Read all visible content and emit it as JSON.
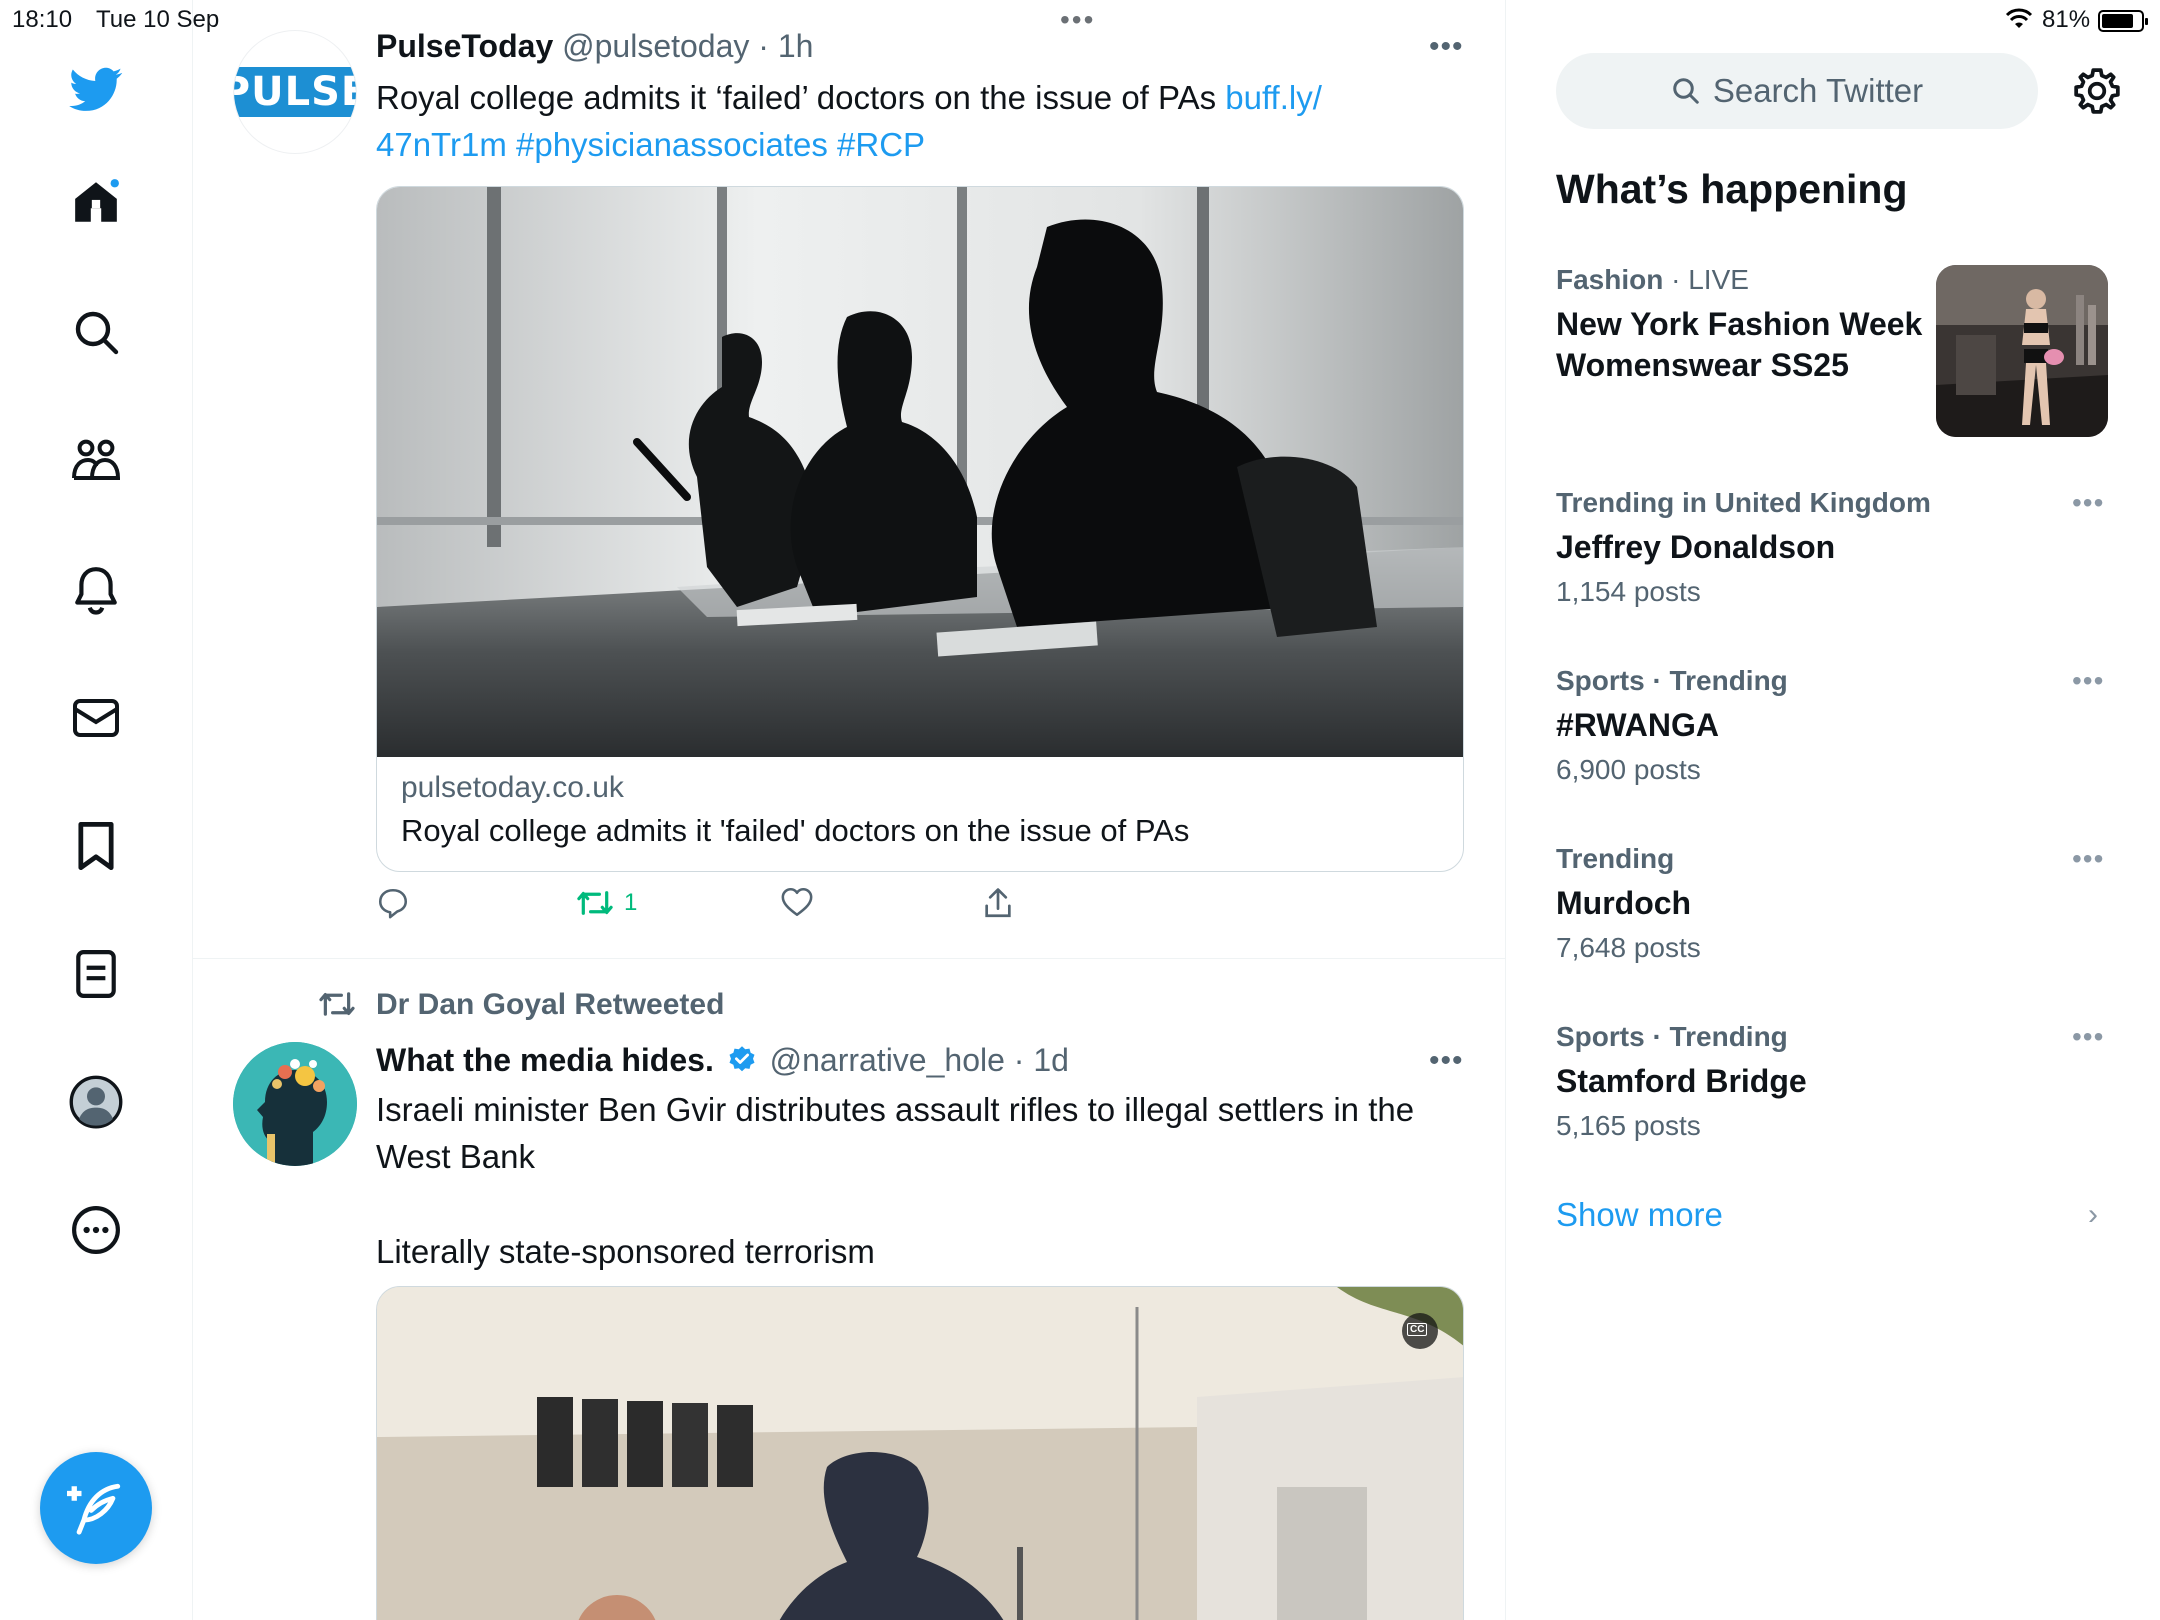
{
  "status_bar": {
    "time": "18:10",
    "date": "Tue 10 Sep",
    "battery_pct": "81%",
    "battery_level": 0.81
  },
  "nav": {
    "items": [
      {
        "name": "home",
        "icon": "home-icon"
      },
      {
        "name": "search",
        "icon": "search-icon"
      },
      {
        "name": "communities",
        "icon": "people-icon"
      },
      {
        "name": "notifications",
        "icon": "bell-icon"
      },
      {
        "name": "messages",
        "icon": "mail-icon"
      },
      {
        "name": "bookmarks",
        "icon": "bookmark-icon"
      },
      {
        "name": "lists",
        "icon": "list-icon"
      },
      {
        "name": "profile",
        "icon": "avatar-icon"
      },
      {
        "name": "more",
        "icon": "more-circle-icon"
      }
    ],
    "compose_icon": "compose-feather-icon",
    "brand_color": "#1d9bf0"
  },
  "tweets": [
    {
      "name": "PulseToday",
      "handle": "@pulsetoday",
      "sep": " · ",
      "time": "1h",
      "avatar_logo": "PULSE",
      "text_main": "Royal college admits it ‘failed’ doctors on the issue of PAs ",
      "text_link": "buff.ly/\n47nTr1m",
      "text_tags": " #physicianassociates #RCP",
      "card_domain": "pulsetoday.co.uk",
      "card_title": "Royal college admits it 'failed' doctors on the issue of PAs",
      "retweets": "1",
      "retweet_color": "#00ba7c"
    },
    {
      "retweeted_by": "Dr Dan Goyal Retweeted",
      "name": "What the media hides.",
      "verified": true,
      "handle": "@narrative_hole",
      "sep": " · ",
      "time": "1d",
      "text_line1": "Israeli minister Ben Gvir distributes assault rifles to illegal settlers in the West Bank",
      "text_line2": "Literally state-sponsored terrorism",
      "cc_label": "CC"
    }
  ],
  "right": {
    "search_placeholder": "Search Twitter",
    "section_title": "What’s happening",
    "trends": [
      {
        "context": "Fashion",
        "context_suffix": " · LIVE",
        "name": "New York Fashion Week Womenswear SS25",
        "posts": ""
      },
      {
        "context": "Trending in United Kingdom",
        "name": "Jeffrey Donaldson",
        "posts": "1,154 posts"
      },
      {
        "context": "Sports · Trending",
        "name": "#RWANGA",
        "posts": "6,900 posts"
      },
      {
        "context": "Trending",
        "name": "Murdoch",
        "posts": "7,648 posts"
      },
      {
        "context": "Sports · Trending",
        "name": "Stamford Bridge",
        "posts": "5,165 posts"
      }
    ],
    "show_more": "Show more"
  }
}
